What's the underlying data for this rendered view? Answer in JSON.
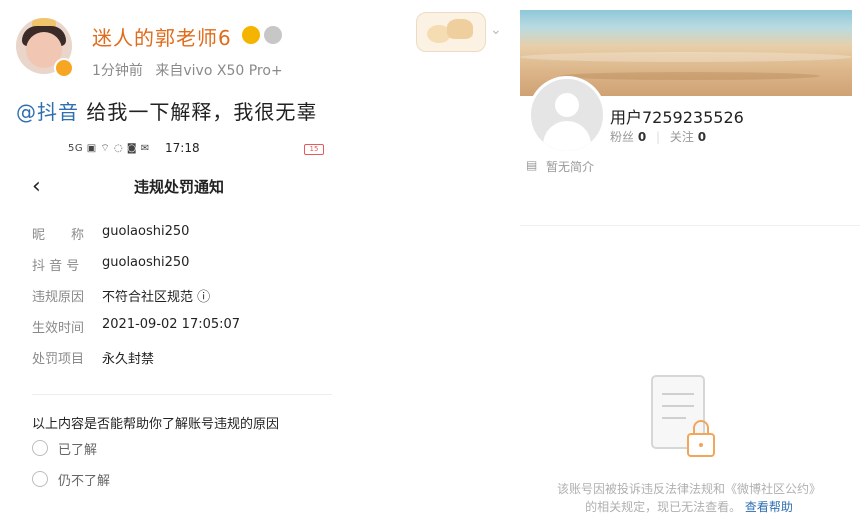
{
  "left_post": {
    "username": "迷人的郭老师6",
    "time": "1分钟前",
    "source": "来自vivo X50 Pro+",
    "mention": "@抖音",
    "text": " 给我一下解释，我很无辜"
  },
  "inner_screen": {
    "status_icons": "5G  ▣ ⌔ ◌ ◙ ✉",
    "time": "17:18",
    "battery": "15",
    "back_icon": "‹",
    "title": "违规处罚通知",
    "fields": [
      {
        "label": "昵　　称",
        "value": "guolaoshi250"
      },
      {
        "label": "抖 音 号",
        "value": "guolaoshi250"
      },
      {
        "label": "违规原因",
        "value": "不符合社区规范 ⓘ"
      },
      {
        "label": "生效时间",
        "value": "2021-09-02 17:05:07"
      },
      {
        "label": "处罚项目",
        "value": "永久封禁"
      }
    ],
    "question": "以上内容是否能帮助你了解账号违规的原因",
    "options": [
      "已了解",
      "仍不了解"
    ]
  },
  "right_profile": {
    "username": "用户7259235526",
    "followers_label": "粉丝",
    "followers_count": "0",
    "following_label": "关注",
    "following_count": "0",
    "intro": "暂无简介",
    "notice_text": "该账号因被投诉违反法律法规和《微博社区公约》的相关规定，现已无法查看。",
    "help_link": "查看帮助"
  },
  "colors": {
    "accent_orange": "#e06b1a",
    "link_blue": "#2f6fb0",
    "lock_orange": "#f2a65a"
  }
}
